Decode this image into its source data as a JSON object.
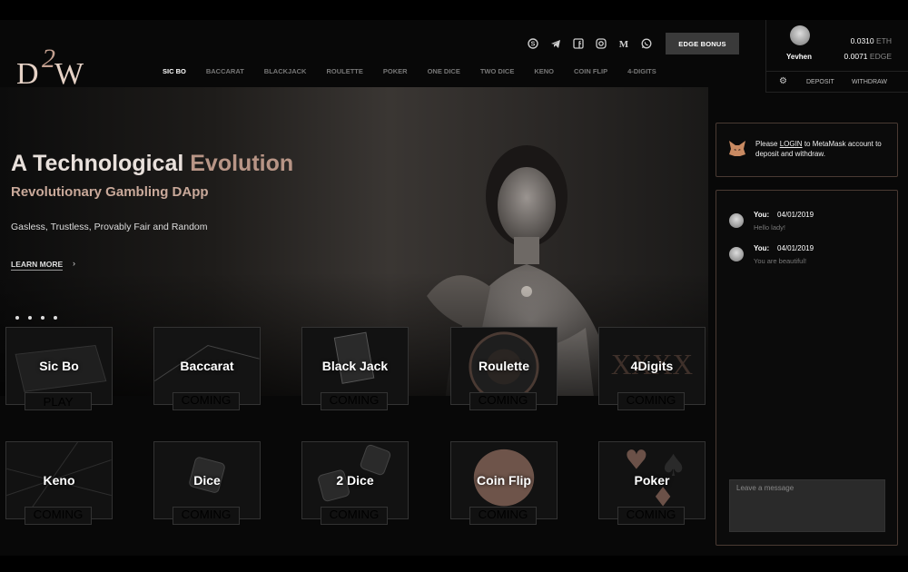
{
  "brand": {
    "logo_text": "D2W"
  },
  "header": {
    "social_icons": [
      "skype-icon",
      "telegram-icon",
      "facebook-icon",
      "instagram-icon",
      "medium-icon",
      "whatsapp-icon"
    ],
    "edge_bonus_label": "EDGE BONUS",
    "nav": [
      "SIC BO",
      "BACCARAT",
      "BLACKJACK",
      "ROULETTE",
      "POKER",
      "ONE DICE",
      "TWO DICE",
      "KENO",
      "COIN FLIP",
      "4-DIGITS"
    ],
    "nav_active": "SIC BO"
  },
  "account": {
    "username": "Yevhen",
    "eth_amount": "0.0310",
    "eth_unit": "ETH",
    "edge_amount": "0.0071",
    "edge_unit": "EDGE",
    "deposit_label": "DEPOSIT",
    "withdraw_label": "WITHDRAW"
  },
  "hero": {
    "title_part1": "A Technological ",
    "title_part2": "Evolution",
    "subtitle": "Revolutionary Gambling DApp",
    "description": "Gasless, Trustless, Provably Fair and Random",
    "learn_more": "LEARN MORE",
    "slide_count": 4
  },
  "games": [
    {
      "name": "Sic Bo",
      "button": "PLAY"
    },
    {
      "name": "Baccarat",
      "button": "COMING SOON"
    },
    {
      "name": "Black Jack",
      "button": "COMING SOON"
    },
    {
      "name": "Roulette",
      "button": "COMING SOON"
    },
    {
      "name": "4Digits",
      "button": "COMING SOON"
    },
    {
      "name": "Keno",
      "button": "COMING SOON"
    },
    {
      "name": "Dice",
      "button": "COMING SOON"
    },
    {
      "name": "2 Dice",
      "button": "COMING SOON"
    },
    {
      "name": "Coin Flip",
      "button": "COMING SOON"
    },
    {
      "name": "Poker",
      "button": "COMING SOON"
    }
  ],
  "metamask": {
    "text_before": "Please ",
    "login_link": "LOGIN",
    "text_after": " to MetaMask account to deposit and withdraw."
  },
  "chat": {
    "messages": [
      {
        "sender": "You:",
        "date": "04/01/2019",
        "text": "Hello lady!"
      },
      {
        "sender": "You:",
        "date": "04/01/2019",
        "text": "You are beautiful!"
      }
    ],
    "input_placeholder": "Leave a message"
  },
  "colors": {
    "accent": "#c9a99a",
    "background": "#080808",
    "panel_border": "#4a3a33"
  }
}
